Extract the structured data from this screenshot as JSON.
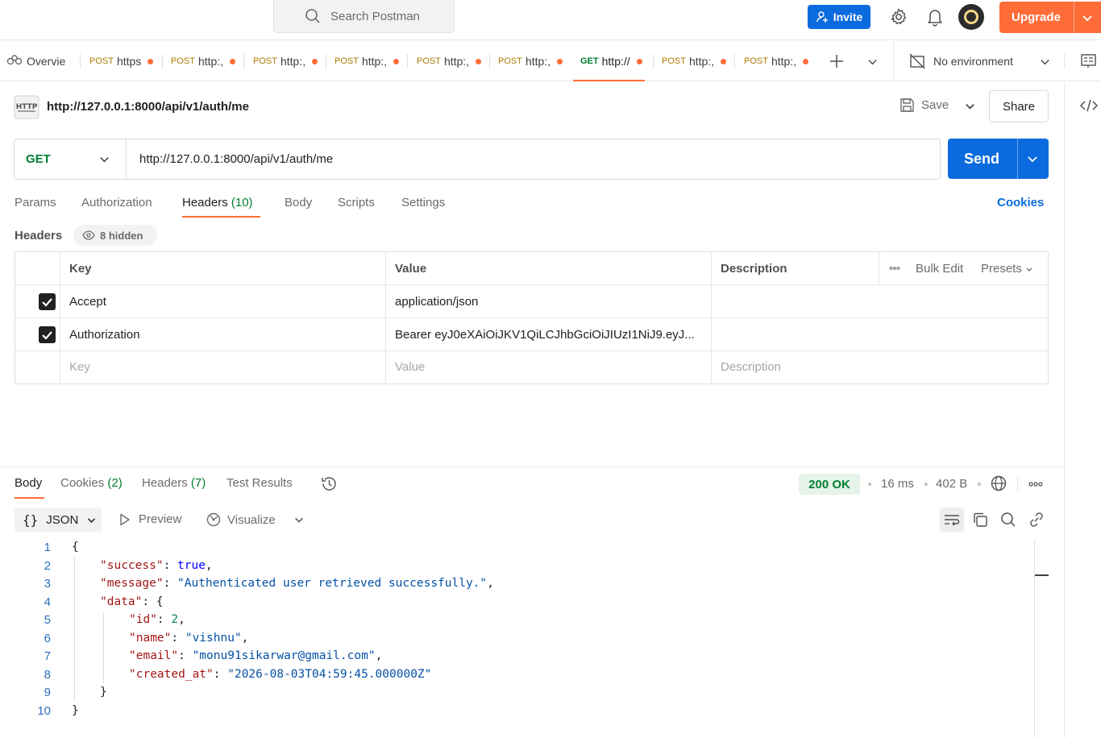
{
  "topbar": {
    "search_placeholder": "Search Postman",
    "invite_label": "Invite",
    "upgrade_label": "Upgrade"
  },
  "tabs": {
    "overview_label": "Overvie",
    "items": [
      {
        "method": "POST",
        "title": "https"
      },
      {
        "method": "POST",
        "title": "http:,"
      },
      {
        "method": "POST",
        "title": "http:,"
      },
      {
        "method": "POST",
        "title": "http:,"
      },
      {
        "method": "POST",
        "title": "http:,"
      },
      {
        "method": "POST",
        "title": "http:,"
      },
      {
        "method": "GET",
        "title": "http://"
      },
      {
        "method": "POST",
        "title": "http:,"
      },
      {
        "method": "POST",
        "title": "http:,"
      }
    ],
    "environment": "No environment"
  },
  "request": {
    "title": "http://127.0.0.1:8000/api/v1/auth/me",
    "save_label": "Save",
    "share_label": "Share",
    "method": "GET",
    "url": "http://127.0.0.1:8000/api/v1/auth/me",
    "send_label": "Send",
    "tabs": {
      "params": "Params",
      "authorization": "Authorization",
      "headers": "Headers",
      "headers_count": "(10)",
      "body": "Body",
      "scripts": "Scripts",
      "settings": "Settings",
      "cookies": "Cookies"
    },
    "headers_label": "Headers",
    "hidden_label": "8 hidden",
    "table": {
      "col_key": "Key",
      "col_value": "Value",
      "col_description": "Description",
      "bulk_edit": "Bulk Edit",
      "presets": "Presets",
      "rows": [
        {
          "key": "Accept",
          "value": "application/json",
          "checked": true
        },
        {
          "key": "Authorization",
          "value": "Bearer eyJ0eXAiOiJKV1QiLCJhbGciOiJIUzI1NiJ9.eyJ...",
          "checked": true
        }
      ],
      "placeholder_key": "Key",
      "placeholder_value": "Value",
      "placeholder_description": "Description"
    }
  },
  "response": {
    "tabs": {
      "body": "Body",
      "cookies": "Cookies",
      "cookies_count": "(2)",
      "headers": "Headers",
      "headers_count": "(7)",
      "test_results": "Test Results"
    },
    "status": "200 OK",
    "time": "16 ms",
    "size": "402 B",
    "format": "JSON",
    "preview_label": "Preview",
    "visualize_label": "Visualize",
    "line_numbers": [
      "1",
      "2",
      "3",
      "4",
      "5",
      "6",
      "7",
      "8",
      "9",
      "10"
    ],
    "json": {
      "success_key": "\"success\"",
      "success_val": "true",
      "message_key": "\"message\"",
      "message_val": "\"Authenticated user retrieved successfully.\"",
      "data_key": "\"data\"",
      "id_key": "\"id\"",
      "id_val": "2",
      "name_key": "\"name\"",
      "name_val": "\"vishnu\"",
      "email_key": "\"email\"",
      "email_val": "\"monu91sikarwar@gmail.com\"",
      "created_key": "\"created_at\"",
      "created_val": "\"2026-08-03T04:59:45.000000Z\""
    }
  },
  "colors": {
    "accent": "#ff6c37",
    "primary": "#0b6bde",
    "get_method": "#007f31",
    "post_method": "#ad7a03"
  }
}
